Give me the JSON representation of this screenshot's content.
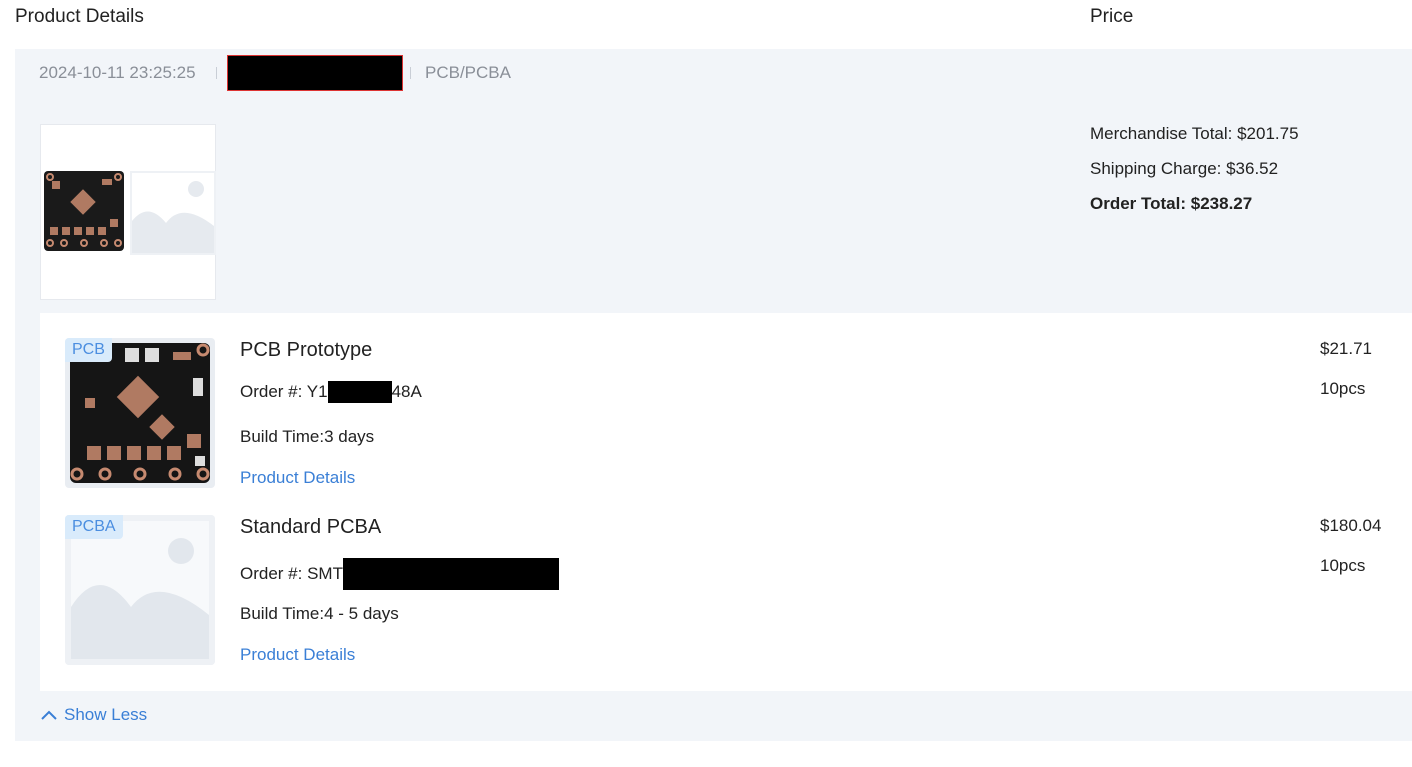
{
  "header": {
    "product_details": "Product Details",
    "price": "Price"
  },
  "order": {
    "datetime": "2024-10-11 23:25:25",
    "category": "PCB/PCBA"
  },
  "totals": {
    "merchandise": "Merchandise Total: $201.75",
    "shipping": "Shipping Charge: $36.52",
    "order_total": "Order Total: $238.27"
  },
  "items": [
    {
      "tag": "PCB",
      "title": "PCB Prototype",
      "order_prefix": "Order #: Y1",
      "order_suffix": "48A",
      "build_time": "Build Time:3 days",
      "details_link": "Product Details",
      "price": "$21.71",
      "qty": "10pcs"
    },
    {
      "tag": "PCBA",
      "title": "Standard PCBA",
      "order_prefix": "Order #: SMT",
      "order_suffix": "",
      "build_time": "Build Time:4 - 5 days",
      "details_link": "Product Details",
      "price": "$180.04",
      "qty": "10pcs"
    }
  ],
  "show_less": "Show Less",
  "icons": [
    "chevron-up-icon",
    "image-placeholder-icon",
    "pcb-image"
  ],
  "colors": {
    "link": "#3a7fd6",
    "card_bg": "#f2f5f9",
    "tag_bg": "#d9ebfb",
    "tag_text": "#4b8ee0"
  }
}
